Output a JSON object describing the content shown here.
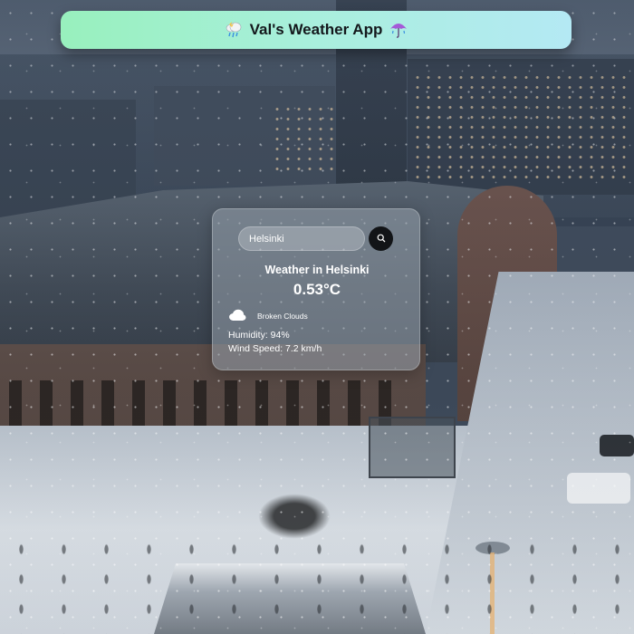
{
  "app": {
    "title": "Val's Weather App",
    "title_icon_left": "cloud-rain-icon",
    "title_icon_right": "umbrella-icon"
  },
  "search": {
    "value": "Helsinki",
    "button_icon": "search-icon"
  },
  "weather": {
    "heading": "Weather in Helsinki",
    "temperature": "0.53°C",
    "condition_icon": "cloud-icon",
    "condition": "Broken Clouds",
    "humidity": "Humidity: 94%",
    "wind": "Wind Speed: 7.2 km/h"
  },
  "colors": {
    "banner_gradient_start": "#98f0bd",
    "banner_gradient_end": "#b4e9f4",
    "card_glass": "rgba(150,160,172,0.55)",
    "search_button": "#121417",
    "text": "#ffffff"
  }
}
